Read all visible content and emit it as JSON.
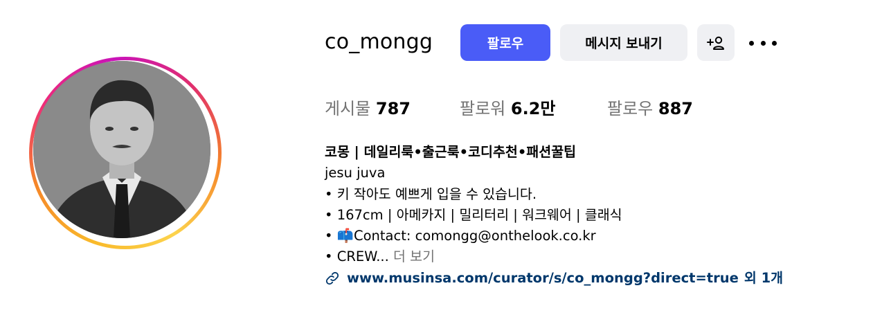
{
  "profile": {
    "username": "co_mongg",
    "follow_label": "팔로우",
    "message_label": "메시지 보내기"
  },
  "stats": {
    "posts_label": "게시물",
    "posts_value": "787",
    "followers_label": "팔로워",
    "followers_value": "6.2만",
    "following_label": "팔로우",
    "following_value": "887"
  },
  "bio": {
    "name": "코몽 | 데일리룩•출근룩•코디추천•패션꿀팁",
    "line1": "jesu juva",
    "line2": "• 키 작아도 예쁘게 입을 수 있습니다.",
    "line3": "• 167cm | 아메카지 | 밀리터리 | 워크웨어 | 클래식",
    "line4": "• 📫Contact: comongg@onthelook.co.kr",
    "line5": "• CREW...",
    "more": "더 보기",
    "link": "www.musinsa.com/curator/s/co_mongg?direct=true",
    "link_extra": "외 1개"
  },
  "colors": {
    "follow_button": "#4a5cf7",
    "secondary_button": "#eff0f3",
    "link": "#00376b",
    "muted_text": "#737373"
  },
  "icons": {
    "add_user": "add-user-icon",
    "more": "more-options-icon",
    "link": "link-icon"
  }
}
